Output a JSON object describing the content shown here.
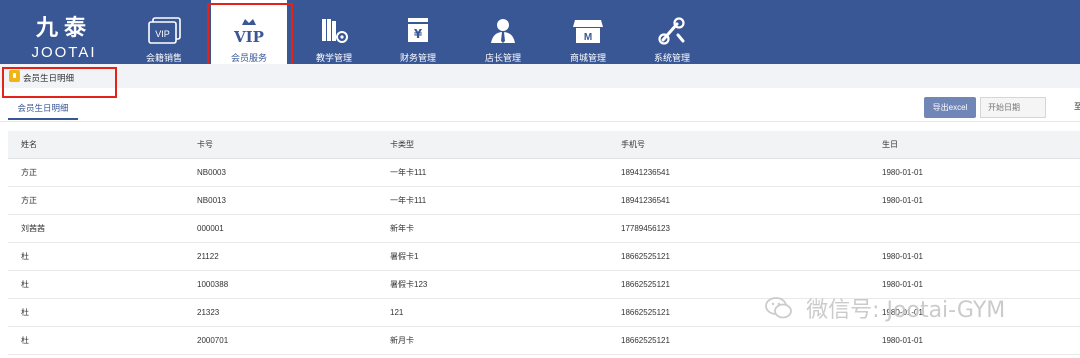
{
  "logo": {
    "glyphs": "九泰",
    "word": "JOOTAI"
  },
  "nav": {
    "items": [
      {
        "label": "会籍销售",
        "icon": "vip-card-icon"
      },
      {
        "label": "会员服务",
        "icon": "vip-crown-icon",
        "active": true
      },
      {
        "label": "教学管理",
        "icon": "books-gear-icon"
      },
      {
        "label": "财务管理",
        "icon": "yen-box-icon"
      },
      {
        "label": "店长管理",
        "icon": "manager-icon"
      },
      {
        "label": "商城管理",
        "icon": "store-icon"
      },
      {
        "label": "系统管理",
        "icon": "settings-tools-icon"
      }
    ]
  },
  "breadcrumb": {
    "text": "会员生日明细",
    "icon": "bulb-icon"
  },
  "tabs": [
    {
      "label": "会员生日明细"
    }
  ],
  "toolbar": {
    "export_label": "导出excel",
    "start_date_placeholder": "开始日期",
    "to_label": "至"
  },
  "table": {
    "headers": [
      "姓名",
      "卡号",
      "卡类型",
      "手机号",
      "生日"
    ],
    "rows": [
      [
        "方正",
        "NB0003",
        "一年卡111",
        "18941236541",
        "1980-01-01"
      ],
      [
        "方正",
        "NB0013",
        "一年卡111",
        "18941236541",
        "1980-01-01"
      ],
      [
        "刘茜茜",
        "000001",
        "新年卡",
        "17789456123",
        ""
      ],
      [
        "杜",
        "21122",
        "暑假卡1",
        "18662525121",
        "1980-01-01"
      ],
      [
        "杜",
        "1000388",
        "暑假卡123",
        "18662525121",
        "1980-01-01"
      ],
      [
        "杜",
        "21323",
        "121",
        "18662525121",
        "1980-01-01"
      ],
      [
        "杜",
        "2000701",
        "新月卡",
        "18662525121",
        "1980-01-01"
      ]
    ]
  },
  "watermark": {
    "text": "微信号: Jootai-GYM"
  },
  "colors": {
    "nav_bg": "#3a5795",
    "highlight_red": "#e32219",
    "bulb": "#f0b416"
  }
}
